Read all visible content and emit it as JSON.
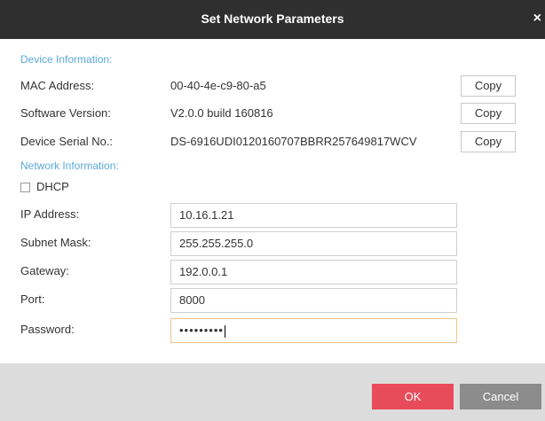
{
  "window": {
    "title": "Set Network Parameters",
    "close_glyph": "×"
  },
  "device_info": {
    "section_label": "Device Information:",
    "mac": {
      "label": "MAC Address:",
      "value": "00-40-4e-c9-80-a5",
      "copy_label": "Copy"
    },
    "software": {
      "label": "Software Version:",
      "value": "V2.0.0 build 160816",
      "copy_label": "Copy"
    },
    "serial": {
      "label": "Device Serial No.:",
      "value": "DS-6916UDI0120160707BBRR257649817WCV",
      "copy_label": "Copy"
    }
  },
  "network_info": {
    "section_label": "Network Information:",
    "dhcp": {
      "label": "DHCP",
      "checked": false
    },
    "ip": {
      "label": "IP Address:",
      "value": "10.16.1.21"
    },
    "subnet": {
      "label": "Subnet Mask:",
      "value": "255.255.255.0"
    },
    "gateway": {
      "label": "Gateway:",
      "value": "192.0.0.1"
    },
    "port": {
      "label": "Port:",
      "value": "8000"
    },
    "password": {
      "label": "Password:",
      "value": "•••••••••"
    }
  },
  "footer": {
    "ok_label": "OK",
    "cancel_label": "Cancel"
  },
  "colors": {
    "titlebar": "#2f2f2f",
    "section_text": "#5aa9dc",
    "ok_button": "#e84c5a",
    "cancel_button": "#8c8c8c",
    "footer_bg": "#dcdcdc",
    "focus_border": "#f0c48a"
  },
  "icons": {
    "close": "close-icon",
    "checkbox": "checkbox-icon"
  }
}
